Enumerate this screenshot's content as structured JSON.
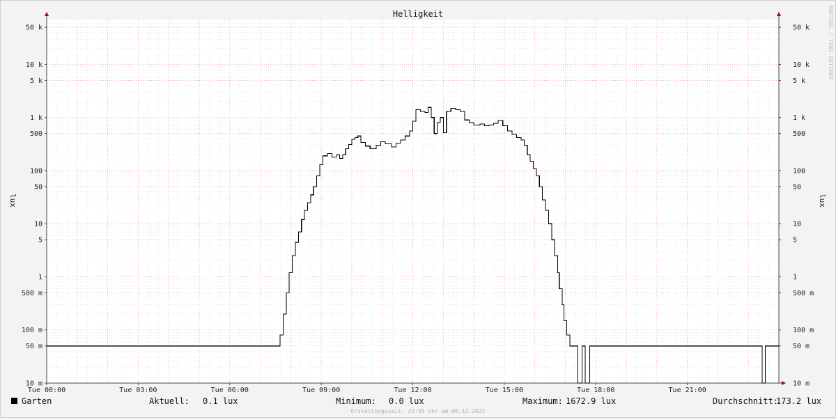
{
  "chart_data": {
    "type": "line",
    "title": "Helligkeit",
    "ylabel": "lux",
    "ylabel_right": "lux",
    "y_scale": "log",
    "ylim": [
      0.01,
      70000
    ],
    "xlim_hours": [
      0,
      24
    ],
    "y_ticks": [
      {
        "value": 50000,
        "label": "50 k"
      },
      {
        "value": 10000,
        "label": "10 k"
      },
      {
        "value": 5000,
        "label": "5 k"
      },
      {
        "value": 1000,
        "label": "1 k"
      },
      {
        "value": 500,
        "label": "500"
      },
      {
        "value": 100,
        "label": "100"
      },
      {
        "value": 50,
        "label": "50"
      },
      {
        "value": 10,
        "label": "10"
      },
      {
        "value": 5,
        "label": "5"
      },
      {
        "value": 1,
        "label": "1"
      },
      {
        "value": 0.5,
        "label": "500 m"
      },
      {
        "value": 0.1,
        "label": "100 m"
      },
      {
        "value": 0.05,
        "label": "50 m"
      },
      {
        "value": 0.01,
        "label": "10 m"
      }
    ],
    "x_ticks": [
      {
        "hour": 0,
        "label": "Tue 00:00"
      },
      {
        "hour": 3,
        "label": "Tue 03:00"
      },
      {
        "hour": 6,
        "label": "Tue 06:00"
      },
      {
        "hour": 9,
        "label": "Tue 09:00"
      },
      {
        "hour": 12,
        "label": "Tue 12:00"
      },
      {
        "hour": 15,
        "label": "Tue 15:00"
      },
      {
        "hour": 18,
        "label": "Tue 18:00"
      },
      {
        "hour": 21,
        "label": "Tue 21:00"
      }
    ],
    "grid": true,
    "series": [
      {
        "name": "Garten",
        "color": "#000000",
        "points": [
          [
            0.0,
            0.05
          ],
          [
            7.6,
            0.05
          ],
          [
            7.65,
            0.08
          ],
          [
            7.75,
            0.2
          ],
          [
            7.85,
            0.5
          ],
          [
            7.95,
            1.2
          ],
          [
            8.05,
            2.5
          ],
          [
            8.15,
            4.5
          ],
          [
            8.25,
            7
          ],
          [
            8.35,
            12
          ],
          [
            8.45,
            18
          ],
          [
            8.55,
            25
          ],
          [
            8.65,
            35
          ],
          [
            8.75,
            50
          ],
          [
            8.85,
            80
          ],
          [
            8.95,
            130
          ],
          [
            9.05,
            190
          ],
          [
            9.2,
            210
          ],
          [
            9.35,
            180
          ],
          [
            9.5,
            200
          ],
          [
            9.6,
            170
          ],
          [
            9.7,
            200
          ],
          [
            9.8,
            260
          ],
          [
            9.9,
            310
          ],
          [
            10.0,
            390
          ],
          [
            10.1,
            420
          ],
          [
            10.2,
            450
          ],
          [
            10.3,
            340
          ],
          [
            10.45,
            290
          ],
          [
            10.6,
            260
          ],
          [
            10.8,
            300
          ],
          [
            10.95,
            350
          ],
          [
            11.1,
            320
          ],
          [
            11.3,
            280
          ],
          [
            11.45,
            330
          ],
          [
            11.6,
            380
          ],
          [
            11.75,
            450
          ],
          [
            11.9,
            560
          ],
          [
            12.0,
            850
          ],
          [
            12.1,
            1400
          ],
          [
            12.25,
            1300
          ],
          [
            12.4,
            1250
          ],
          [
            12.5,
            1550
          ],
          [
            12.6,
            1000
          ],
          [
            12.7,
            500
          ],
          [
            12.8,
            800
          ],
          [
            12.9,
            1000
          ],
          [
            13.0,
            520
          ],
          [
            13.1,
            1300
          ],
          [
            13.25,
            1500
          ],
          [
            13.4,
            1400
          ],
          [
            13.55,
            1300
          ],
          [
            13.7,
            900
          ],
          [
            13.85,
            800
          ],
          [
            14.0,
            720
          ],
          [
            14.2,
            760
          ],
          [
            14.35,
            700
          ],
          [
            14.5,
            720
          ],
          [
            14.65,
            780
          ],
          [
            14.8,
            880
          ],
          [
            14.95,
            700
          ],
          [
            15.1,
            560
          ],
          [
            15.25,
            480
          ],
          [
            15.4,
            420
          ],
          [
            15.55,
            380
          ],
          [
            15.65,
            300
          ],
          [
            15.75,
            200
          ],
          [
            15.85,
            150
          ],
          [
            15.95,
            110
          ],
          [
            16.05,
            80
          ],
          [
            16.15,
            50
          ],
          [
            16.25,
            28
          ],
          [
            16.35,
            18
          ],
          [
            16.45,
            10
          ],
          [
            16.55,
            5
          ],
          [
            16.65,
            2.5
          ],
          [
            16.75,
            1.2
          ],
          [
            16.8,
            0.6
          ],
          [
            16.9,
            0.3
          ],
          [
            16.95,
            0.15
          ],
          [
            17.05,
            0.08
          ],
          [
            17.15,
            0.05
          ],
          [
            17.35,
            0.05
          ],
          [
            17.4,
            0.0
          ],
          [
            17.5,
            0.0
          ],
          [
            17.55,
            0.05
          ],
          [
            17.6,
            0.05
          ],
          [
            17.65,
            0.0
          ],
          [
            17.75,
            0.0
          ],
          [
            17.8,
            0.05
          ],
          [
            23.4,
            0.05
          ],
          [
            23.45,
            0.0
          ],
          [
            23.5,
            0.0
          ],
          [
            23.55,
            0.05
          ],
          [
            24.0,
            0.05
          ]
        ]
      }
    ],
    "stats": {
      "current": "0.1 lux",
      "minimum": "0.0 lux",
      "maximum": "1672.9 lux",
      "average": "173.2 lux"
    }
  },
  "legend": {
    "series_name": "Garten",
    "current_label": "Aktuell:",
    "current_value": "0.1 lux",
    "minimum_label": "Minimum:",
    "minimum_value": "0.0 lux",
    "maximum_label": "Maximum:",
    "maximum_value": "1672.9 lux",
    "average_label": "Durchschnitt:",
    "average_value": "173.2 lux"
  },
  "footer": "Erstellungszeit: 23:55 Uhr am 06.12.2022",
  "watermark": "RRDTOOL / TOBI OETIKER"
}
